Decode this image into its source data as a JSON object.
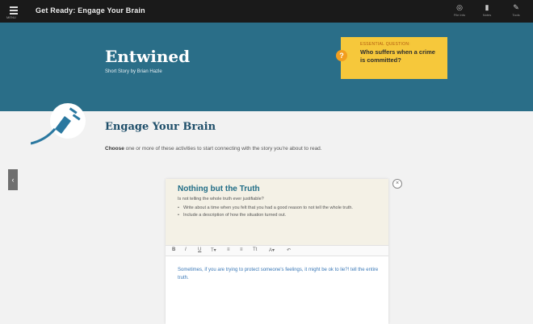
{
  "topbar": {
    "menu_label": "MENU",
    "title": "Get Ready: Engage Your Brain",
    "icons": [
      {
        "name": "file-icon",
        "label": "File Info"
      },
      {
        "name": "notes-icon",
        "label": "Notes"
      },
      {
        "name": "tools-icon",
        "label": "Tools"
      }
    ]
  },
  "hero": {
    "title": "Entwined",
    "subtitle": "Short Story by Brian Hazle",
    "bg": "#2a6e88"
  },
  "essential_question": {
    "label": "ESSENTIAL QUESTION:",
    "text": "Who suffers when a crime is committed?",
    "icon": "question-icon",
    "bg": "#f6c83b"
  },
  "section": {
    "title": "Engage Your Brain",
    "description_bold": "Choose",
    "description_rest": " one or more of these activities to start connecting with the story you're about to read."
  },
  "card": {
    "title": "Nothing but the Truth",
    "question": "Is not telling the whole truth ever justifiable?",
    "bullets": [
      "Write about a time when you felt that you had a good reason to not tell the whole truth.",
      "Include a description of how the situation turned out."
    ],
    "editor_text": "Sometimes, if you are trying to protect someone's feelings, it might be ok to lie?! tell the entire truth."
  },
  "toolbar": {
    "bold": "B",
    "italic": "I",
    "underline": "U",
    "text_color": "T▾",
    "bulleted_list": "≡",
    "numbered_list": "≡",
    "font_size": "Tt",
    "font": "A▾",
    "undo": "↶"
  },
  "side_tab": {
    "label": "‹"
  },
  "close": {
    "label": "×"
  }
}
